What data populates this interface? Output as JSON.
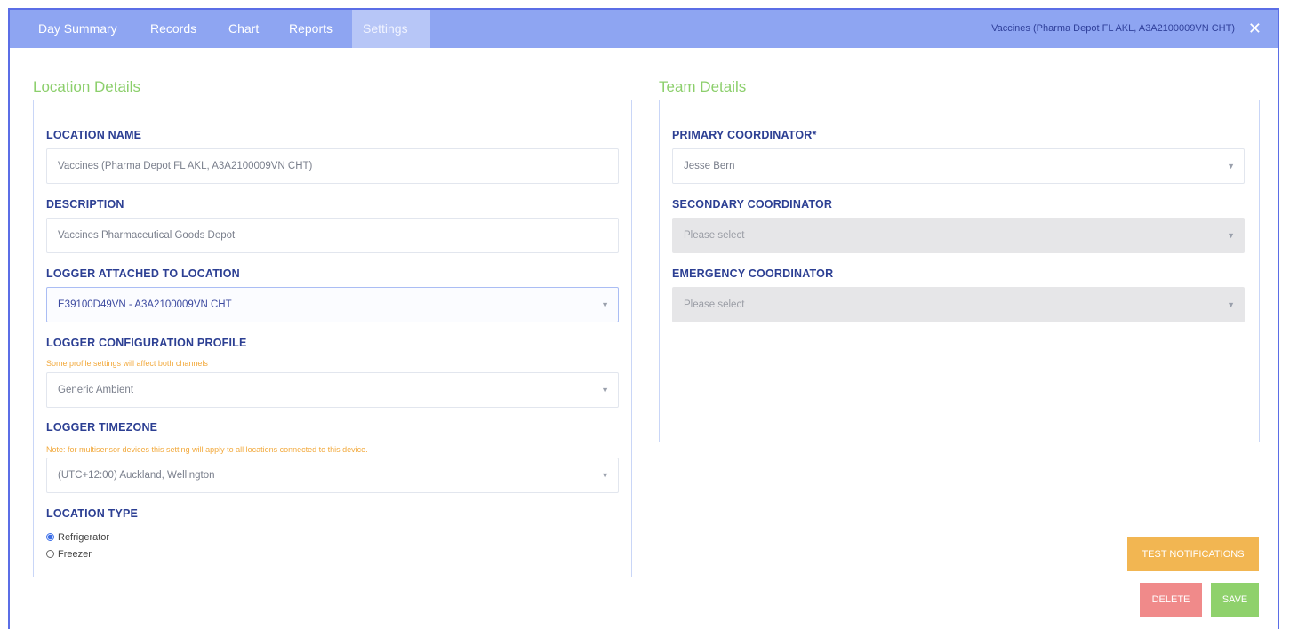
{
  "tabs": [
    {
      "label": "Day Summary"
    },
    {
      "label": "Records"
    },
    {
      "label": "Chart"
    },
    {
      "label": "Reports"
    },
    {
      "label": "Settings"
    }
  ],
  "window_title": "Vaccines (Pharma Depot FL AKL, A3A2100009VN CHT)",
  "location": {
    "section_title": "Location Details",
    "name_label": "LOCATION NAME",
    "name_value": "Vaccines (Pharma Depot FL AKL, A3A2100009VN CHT)",
    "description_label": "DESCRIPTION",
    "description_value": "Vaccines Pharmaceutical Goods Depot",
    "logger_label": "LOGGER ATTACHED TO LOCATION",
    "logger_value": "E39100D49VN - A3A2100009VN CHT",
    "profile_label": "LOGGER CONFIGURATION PROFILE",
    "profile_note": "Some profile settings will affect both channels",
    "profile_value": "Generic Ambient",
    "timezone_label": "LOGGER TIMEZONE",
    "timezone_note": "Note: for multisensor devices this setting will apply to all locations connected to this device.",
    "timezone_value": "(UTC+12:00) Auckland, Wellington",
    "type_label": "LOCATION TYPE",
    "type_options": [
      "Refrigerator",
      "Freezer"
    ],
    "type_selected": "Refrigerator"
  },
  "team": {
    "section_title": "Team Details",
    "primary_label": "PRIMARY COORDINATOR*",
    "primary_value": "Jesse Bern",
    "secondary_label": "SECONDARY COORDINATOR",
    "secondary_value": "Please select",
    "emergency_label": "EMERGENCY COORDINATOR",
    "emergency_value": "Please select"
  },
  "buttons": {
    "test_notifications": "TEST NOTIFICATIONS",
    "delete": "DELETE",
    "save": "SAVE"
  },
  "colors": {
    "topbar": "#8ea5f2",
    "section_title": "#8ccf6c",
    "label": "#2c3f93",
    "test_button": "#f2b652",
    "delete_button": "#f08a8a",
    "save_button": "#8fd16c"
  }
}
